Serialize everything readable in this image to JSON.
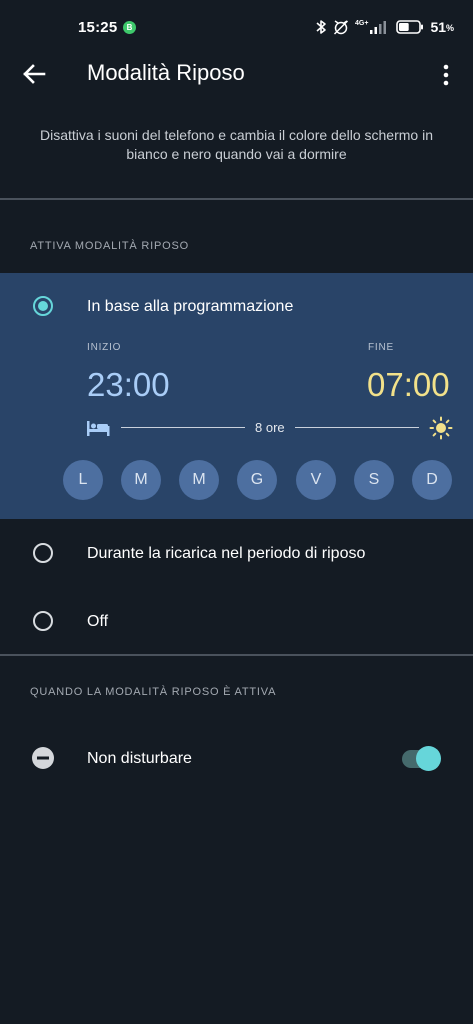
{
  "status_bar": {
    "time": "15:25",
    "notif_badge": "B",
    "network": "4G+",
    "battery_percent": "51",
    "percent_sign": "%",
    "battery_level": 0.51
  },
  "app_bar": {
    "title": "Modalità Riposo",
    "back_icon": "arrow-left-icon",
    "menu_icon": "more-vert-icon"
  },
  "description": "Disattiva i suoni del telefono e cambia il colore dello schermo in bianco e nero quando vai a dormire",
  "activate_section": {
    "header": "ATTIVA MODALITÀ RIPOSO",
    "schedule_option": {
      "label": "In base alla programmazione",
      "selected": true,
      "start_label": "INIZIO",
      "start_time": "23:00",
      "end_label": "FINE",
      "end_time": "07:00",
      "duration": "8 ore",
      "days": [
        "L",
        "M",
        "M",
        "G",
        "V",
        "S",
        "D"
      ]
    },
    "charging_option": {
      "label": "Durante la ricarica nel periodo di riposo",
      "selected": false
    },
    "off_option": {
      "label": "Off",
      "selected": false
    }
  },
  "active_section": {
    "header": "QUANDO LA MODALITÀ RIPOSO È ATTIVA",
    "dnd": {
      "label": "Non disturbare",
      "enabled": true,
      "icon": "do-not-disturb-icon"
    }
  },
  "colors": {
    "background": "#141b23",
    "card": "#294468",
    "accent": "#66d6da",
    "start_time": "#a9cdf7",
    "end_time": "#f2e18a",
    "day_chip": "#4d6fa0"
  }
}
